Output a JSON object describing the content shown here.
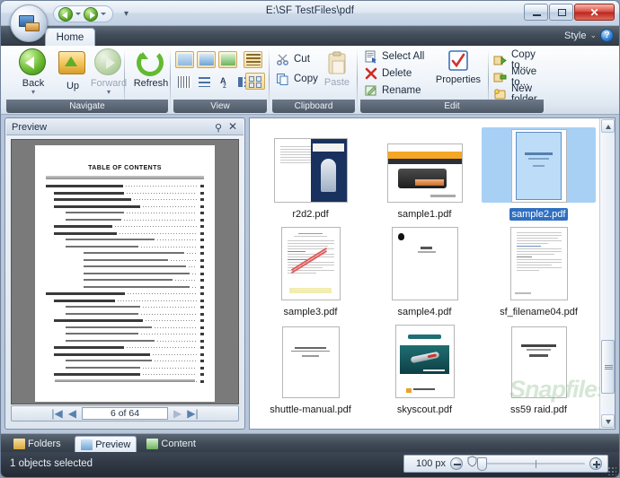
{
  "window": {
    "title": "E:\\SF TestFiles\\pdf",
    "orb_icon": "computer-orb-icon",
    "nav_back_icon": "back-arrow-icon",
    "nav_forward_icon": "forward-arrow-icon",
    "quick_access_caret": "▾",
    "minimize_label": "–",
    "maximize_label": "□",
    "close_label": "✕"
  },
  "tabs": {
    "home": "Home",
    "style_label": "Style",
    "style_caret": "⌄",
    "help_label": "?"
  },
  "ribbon": {
    "groups": [
      {
        "name": "Navigate",
        "label": "Navigate",
        "buttons": [
          {
            "label": "Back",
            "icon": "back-circle-icon",
            "disabled": false,
            "has_caret": true
          },
          {
            "label": "Up",
            "icon": "folder-up-icon",
            "disabled": false,
            "has_caret": false
          },
          {
            "label": "Forward",
            "icon": "forward-circle-icon",
            "disabled": true,
            "has_caret": true
          },
          {
            "label": "Refresh",
            "icon": "refresh-icon",
            "disabled": false,
            "has_caret": false
          }
        ]
      },
      {
        "name": "View",
        "label": "View",
        "top_icons": [
          "preview-pane-icon",
          "thumbnails-icon",
          "content-pane-icon",
          "details-grid-icon"
        ],
        "bottom_icons": [
          "list-grid-icon",
          "small-icons-icon",
          "sort-icon",
          "details-list-icon",
          "tiles-icon"
        ]
      },
      {
        "name": "Clipboard",
        "label": "Clipboard",
        "items": [
          {
            "label": "Cut",
            "icon": "scissors-icon",
            "disabled": false
          },
          {
            "label": "Copy",
            "icon": "copy-icon",
            "disabled": false
          },
          {
            "label": "Paste",
            "icon": "paste-icon",
            "disabled": true
          }
        ]
      },
      {
        "name": "Edit",
        "label": "Edit",
        "items": [
          {
            "label": "Select All",
            "icon": "select-all-icon"
          },
          {
            "label": "Delete",
            "icon": "delete-x-icon"
          },
          {
            "label": "Rename",
            "icon": "rename-icon"
          },
          {
            "label": "Properties",
            "icon": "properties-check-icon"
          },
          {
            "label": "Copy to...",
            "icon": "copy-to-icon"
          },
          {
            "label": "Move to...",
            "icon": "move-to-icon"
          },
          {
            "label": "New folder",
            "icon": "new-folder-icon"
          }
        ]
      }
    ]
  },
  "preview": {
    "title": "Preview",
    "pin_icon": "pin-icon",
    "close_icon": "close-icon",
    "page_indicator": "6 of 64",
    "first_page_icon": "first-page-icon",
    "prev_page_icon": "prev-page-icon",
    "next_page_icon": "next-page-icon",
    "last_page_icon": "last-page-icon",
    "document": {
      "heading": "TABLE OF CONTENTS",
      "entries": [
        {
          "text": "1 Function Introduction",
          "level": 0,
          "page": "1"
        },
        {
          "text": "1.1 SFC Introduction",
          "level": 1,
          "page": "1"
        },
        {
          "text": "1.2 Model Specification",
          "level": 1,
          "page": "2"
        },
        {
          "text": "1.3 SFC Exterior Decoration",
          "level": 1,
          "page": "3"
        },
        {
          "text": "1.3.1 SFC Front",
          "level": 2,
          "page": "3"
        },
        {
          "text": "1.3.2 SFC Back",
          "level": 2,
          "page": "4"
        },
        {
          "text": "1.4 Accessories",
          "level": 1,
          "page": "5"
        },
        {
          "text": "1.5 SFC Mainboard",
          "level": 1,
          "page": "6"
        },
        {
          "text": "1.5.1 DIMM Embedded Baseline",
          "level": 2,
          "page": "6"
        },
        {
          "text": "1.5.2 Jumper Settings",
          "level": 2,
          "page": "7"
        },
        {
          "text": "Front Panel Connector (JPF6/JPF8)",
          "level": 3,
          "page": "7"
        },
        {
          "text": "Fan Connectors (FAN1/FAN2)",
          "level": 3,
          "page": "7"
        },
        {
          "text": "Extended USB Connector (USB7/USB8)",
          "level": 3,
          "page": "8"
        },
        {
          "text": "LINE-in(JL1),CD-in(CN2),Mini CD-in(CN3) Connectors",
          "level": 3,
          "page": "8"
        },
        {
          "text": "SPDIF In/Out Connector (JP6)",
          "level": 3,
          "page": "9"
        },
        {
          "text": "Parallel Port Header EXT. Printer Port (JP17)",
          "level": 3,
          "page": "9"
        },
        {
          "text": "2 SFC Installation Guide",
          "level": 0,
          "page": "10"
        },
        {
          "text": "2.1 Installation",
          "level": 1,
          "page": "10"
        },
        {
          "text": "2.1.1 Remove the Cover",
          "level": 2,
          "page": "10"
        },
        {
          "text": "2.1.2 Remove the Rack",
          "level": 2,
          "page": "11"
        },
        {
          "text": "2.2 CPU and ICH Installation",
          "level": 1,
          "page": "12"
        },
        {
          "text": "2.2.1 Remove the ICH Module",
          "level": 2,
          "page": "12"
        },
        {
          "text": "2.2.2 Install the CPU",
          "level": 2,
          "page": "13"
        },
        {
          "text": "2.2.3 Install the ICH Module",
          "level": 2,
          "page": "15"
        },
        {
          "text": "2.3 DDR Installation",
          "level": 1,
          "page": "17"
        },
        {
          "text": "2.4 Cable and Rack Installation",
          "level": 1,
          "page": "18"
        },
        {
          "text": "2.4.1 Install the FDD Cable",
          "level": 2,
          "page": "18"
        },
        {
          "text": "2.4.2 Install the Rack",
          "level": 2,
          "page": "20"
        },
        {
          "text": "2.5 Peripheral Installation",
          "level": 1,
          "page": "22"
        },
        {
          "text": "2.5.1 Install the Serial ATA HDD",
          "level": 2,
          "page": "22"
        }
      ]
    }
  },
  "files": {
    "rows": [
      [
        {
          "name": "r2d2.pdf",
          "thumb": "r2d2-cover-thumb",
          "selected": false
        },
        {
          "name": "sample1.pdf",
          "thumb": "kodak-printer-thumb",
          "selected": false
        },
        {
          "name": "sample2.pdf",
          "thumb": "blue-user-guide-thumb",
          "selected": true
        }
      ],
      [
        {
          "name": "sample3.pdf",
          "thumb": "confidential-form-thumb",
          "selected": false
        },
        {
          "name": "sample4.pdf",
          "thumb": "apple-ipod-thumb",
          "selected": false
        },
        {
          "name": "sf_filename04.pdf",
          "thumb": "text-document-thumb",
          "selected": false
        }
      ],
      [
        {
          "name": "shuttle-manual.pdf",
          "thumb": "shuttle-user-guide-thumb",
          "selected": false
        },
        {
          "name": "skyscout.pdf",
          "thumb": "skyscout-manual-thumb",
          "selected": false
        },
        {
          "name": "ss59 raid.pdf",
          "thumb": "raid-software-manual-thumb",
          "selected": false
        }
      ]
    ],
    "scrollbar_up_icon": "scroll-up-icon",
    "scrollbar_down_icon": "scroll-down-icon"
  },
  "watermark": "Snapfiles",
  "bottom_tabs": [
    {
      "label": "Folders",
      "icon": "folders-icon",
      "active": false
    },
    {
      "label": "Preview",
      "icon": "preview-icon",
      "active": true
    },
    {
      "label": "Content",
      "icon": "content-icon",
      "active": false
    }
  ],
  "status": {
    "text": "1 objects selected",
    "zoom_value": "100 px",
    "zoom_out_icon": "zoom-out-icon",
    "zoom_in_icon": "zoom-in-icon",
    "shield_icon": "shield-icon"
  },
  "colors": {
    "accent": "#2f6fbf",
    "selection_fill": "#a8d0f5",
    "titlebar": "#dde6f1",
    "ribbon_group_label": "#4d5866",
    "close_button": "#d9463a"
  }
}
